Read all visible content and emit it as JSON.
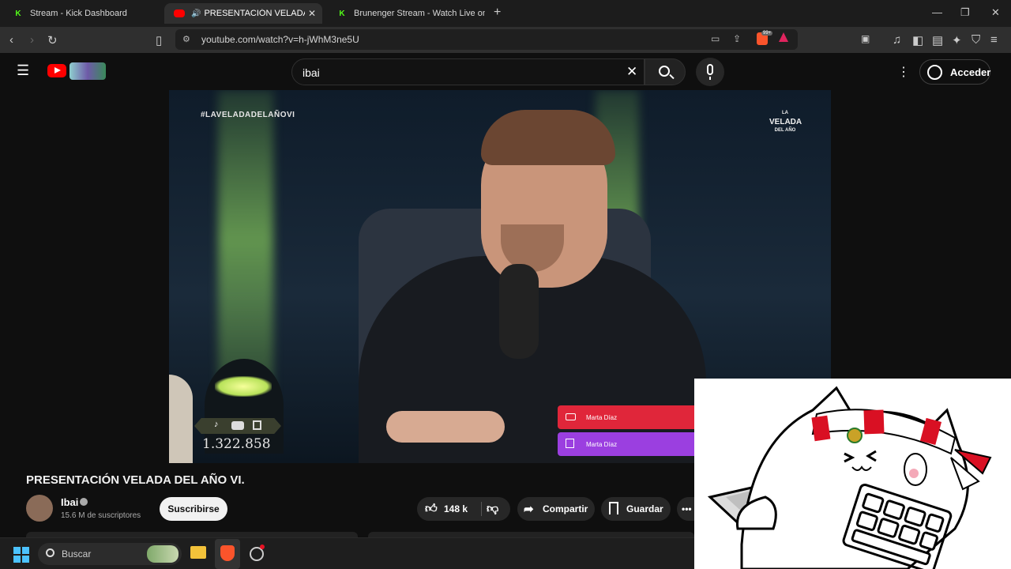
{
  "browser": {
    "tabs": [
      {
        "title": "Stream - Kick Dashboard",
        "icon": "kick-logo-icon"
      },
      {
        "title": "PRESENTACIÓN VELADA DEL",
        "icon": "youtube-logo-icon",
        "audio": "speaker-icon"
      },
      {
        "title": "Brunenger Stream - Watch Live on Ki",
        "icon": "kick-logo-icon"
      }
    ],
    "new_tab": "+",
    "url": "youtube.com/watch?v=h-jWhM3ne5U",
    "brave_badge": "99+"
  },
  "youtube": {
    "search_value": "ibai",
    "sign_in_label": "Acceder"
  },
  "video": {
    "hashtag": "#LAVELADADELAÑOVI",
    "logo_text": [
      "LA",
      "VELADA",
      "DEL AÑO"
    ],
    "counter": "1.322.858",
    "donations": [
      {
        "name": "Marta Díaz",
        "color": "#e0263a"
      },
      {
        "name": "Marta Díaz",
        "color": "#9b3fe0"
      }
    ]
  },
  "info": {
    "title": "PRESENTACIÓN VELADA DEL AÑO VI.",
    "channel": "Ibai",
    "subscribers": "15.6 M de suscriptores",
    "subscribe_label": "Suscribirse",
    "likes": "148 k",
    "share_label": "Compartir",
    "save_label": "Guardar"
  },
  "taskbar": {
    "search_label": "Buscar"
  },
  "colors": {
    "youtube_red": "#ff0000",
    "kick_green": "#53fc18",
    "brave_orange": "#fb542b"
  }
}
